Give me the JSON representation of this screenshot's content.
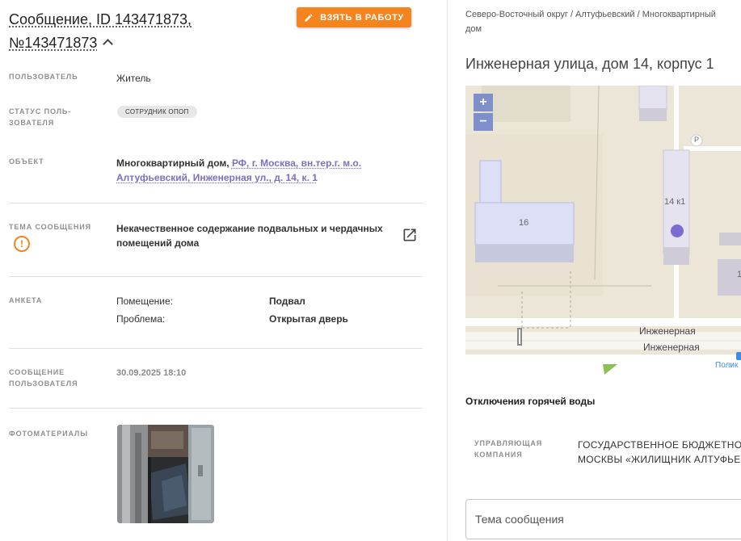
{
  "message": {
    "title": "Сообщение, ID 143471873, №143471873",
    "take_button_label": "ВЗЯТЬ В РАБОТУ"
  },
  "fields": {
    "user_label": "ПОЛЬЗОВАТЕЛЬ",
    "user_value": "Житель",
    "user_status_label": "СТАТУС ПОЛЬ- ЗОВАТЕЛЯ",
    "user_status_badge": "СОТРУДНИК ОПОП",
    "object_label": "ОБЪЕКТ",
    "object_type": "Многоквартирный дом,",
    "object_address_link": "РФ, г. Москва, вн.тер.г. м.о. Алтуфьевский, Инженерная ул., д. 14, к. 1",
    "topic_label": "ТЕМА СООБЩЕНИЯ",
    "topic_value": "Некачественное содержание подвальных и чердачных помещений дома",
    "survey_label": "АНКЕТА",
    "survey_rows": [
      {
        "key": "Помещение:",
        "value": "Подвал"
      },
      {
        "key": "Проблема:",
        "value": "Открытая дверь"
      }
    ],
    "user_message_label": "СООБЩЕНИЕ ПОЛЬЗОВАТЕЛЯ",
    "user_message_date": "30.09.2025 18:10",
    "photos_label": "ФОТОМАТЕРИАЛЫ"
  },
  "location": {
    "breadcrumb": "Северо-Восточный округ / Алтуфьевский / Многоквартирный дом",
    "address": "Инженерная улица, дом 14, корпус 1"
  },
  "map": {
    "zoom_in": "+",
    "zoom_out": "−",
    "building_16": "16",
    "building_14k1": "14 к1",
    "street_label_1": "Инженерная",
    "street_label_2": "Инженерная",
    "poi_label": "Полик",
    "parking": "P",
    "partial_number": "1"
  },
  "hot_water": {
    "title": "Отключения горячей воды"
  },
  "management": {
    "label": "УПРАВЛЯЮЩАЯ КОМПАНИЯ",
    "value_line1": "ГОСУДАРСТВЕННОЕ БЮДЖЕТНОЕ",
    "value_line2": "МОСКВЫ «ЖИЛИЩНИК АЛТУФЬЕВ"
  },
  "subject_input": {
    "placeholder": "Тема сообщения",
    "value": ""
  },
  "colors": {
    "accent_orange": "#f5841f",
    "link_purple": "#7e6fbf",
    "map_marker": "#7c6bd0",
    "zoom_button": "#7f8fc9"
  }
}
